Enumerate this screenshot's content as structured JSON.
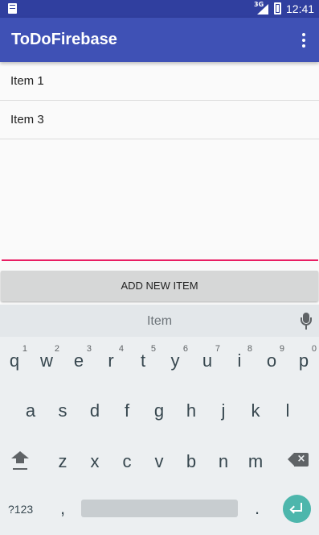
{
  "status_bar": {
    "network": "3G",
    "time": "12:41"
  },
  "app_bar": {
    "title": "ToDoFirebase",
    "menu_icon": "more-vert-icon"
  },
  "list": {
    "items": [
      "Item 1",
      "Item 3"
    ]
  },
  "input": {
    "value": "",
    "accent_color": "#e91e63"
  },
  "add_button": {
    "label": "ADD NEW ITEM"
  },
  "keyboard": {
    "suggestion": "Item",
    "row1": [
      {
        "key": "q",
        "hint": "1"
      },
      {
        "key": "w",
        "hint": "2"
      },
      {
        "key": "e",
        "hint": "3"
      },
      {
        "key": "r",
        "hint": "4"
      },
      {
        "key": "t",
        "hint": "5"
      },
      {
        "key": "y",
        "hint": "6"
      },
      {
        "key": "u",
        "hint": "7"
      },
      {
        "key": "i",
        "hint": "8"
      },
      {
        "key": "o",
        "hint": "9"
      },
      {
        "key": "p",
        "hint": "0"
      }
    ],
    "row2": [
      "a",
      "s",
      "d",
      "f",
      "g",
      "h",
      "j",
      "k",
      "l"
    ],
    "row3": [
      "z",
      "x",
      "c",
      "v",
      "b",
      "n",
      "m"
    ],
    "symbols_label": "?123",
    "comma": ",",
    "period": "."
  },
  "colors": {
    "status_bar": "#303f9f",
    "app_bar": "#3f51b5",
    "enter_key": "#4db6ac"
  }
}
